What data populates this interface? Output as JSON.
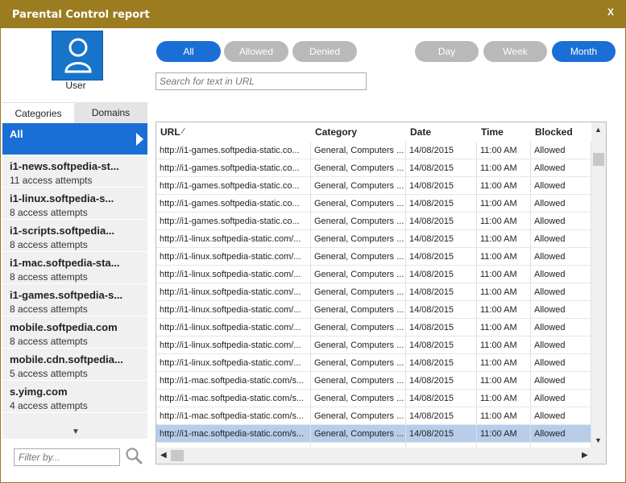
{
  "window": {
    "title": "Parental Control report",
    "close_label": "X"
  },
  "user": {
    "label": "User"
  },
  "tabs": {
    "categories": "Categories",
    "domains": "Domains"
  },
  "filters": {
    "all": "All",
    "allowed": "Allowed",
    "denied": "Denied"
  },
  "periods": {
    "day": "Day",
    "week": "Week",
    "month": "Month"
  },
  "search": {
    "url_placeholder": "Search for text in URL",
    "filter_placeholder": "Filter by..."
  },
  "domains": [
    {
      "name": "All",
      "sub": ""
    },
    {
      "name": "i1-news.softpedia-st...",
      "sub": "11 access attempts"
    },
    {
      "name": "i1-linux.softpedia-s...",
      "sub": "8 access attempts"
    },
    {
      "name": "i1-scripts.softpedia...",
      "sub": "8 access attempts"
    },
    {
      "name": "i1-mac.softpedia-sta...",
      "sub": "8 access attempts"
    },
    {
      "name": "i1-games.softpedia-s...",
      "sub": "8 access attempts"
    },
    {
      "name": "mobile.softpedia.com",
      "sub": "8 access attempts"
    },
    {
      "name": "mobile.cdn.softpedia...",
      "sub": "5 access attempts"
    },
    {
      "name": "s.yimg.com",
      "sub": "4 access attempts"
    }
  ],
  "columns": {
    "url": "URL",
    "url_sort": "⁄",
    "category": "Category",
    "date": "Date",
    "time": "Time",
    "blocked": "Blocked"
  },
  "rows": [
    {
      "url": "http://i1-games.softpedia-static.co...",
      "category": "General, Computers ...",
      "date": "14/08/2015",
      "time": "11:00 AM",
      "blocked": "Allowed"
    },
    {
      "url": "http://i1-games.softpedia-static.co...",
      "category": "General, Computers ...",
      "date": "14/08/2015",
      "time": "11:00 AM",
      "blocked": "Allowed"
    },
    {
      "url": "http://i1-games.softpedia-static.co...",
      "category": "General, Computers ...",
      "date": "14/08/2015",
      "time": "11:00 AM",
      "blocked": "Allowed"
    },
    {
      "url": "http://i1-games.softpedia-static.co...",
      "category": "General, Computers ...",
      "date": "14/08/2015",
      "time": "11:00 AM",
      "blocked": "Allowed"
    },
    {
      "url": "http://i1-games.softpedia-static.co...",
      "category": "General, Computers ...",
      "date": "14/08/2015",
      "time": "11:00 AM",
      "blocked": "Allowed"
    },
    {
      "url": "http://i1-linux.softpedia-static.com/...",
      "category": "General, Computers ...",
      "date": "14/08/2015",
      "time": "11:00 AM",
      "blocked": "Allowed"
    },
    {
      "url": "http://i1-linux.softpedia-static.com/...",
      "category": "General, Computers ...",
      "date": "14/08/2015",
      "time": "11:00 AM",
      "blocked": "Allowed"
    },
    {
      "url": "http://i1-linux.softpedia-static.com/...",
      "category": "General, Computers ...",
      "date": "14/08/2015",
      "time": "11:00 AM",
      "blocked": "Allowed"
    },
    {
      "url": "http://i1-linux.softpedia-static.com/...",
      "category": "General, Computers ...",
      "date": "14/08/2015",
      "time": "11:00 AM",
      "blocked": "Allowed"
    },
    {
      "url": "http://i1-linux.softpedia-static.com/...",
      "category": "General, Computers ...",
      "date": "14/08/2015",
      "time": "11:00 AM",
      "blocked": "Allowed"
    },
    {
      "url": "http://i1-linux.softpedia-static.com/...",
      "category": "General, Computers ...",
      "date": "14/08/2015",
      "time": "11:00 AM",
      "blocked": "Allowed"
    },
    {
      "url": "http://i1-linux.softpedia-static.com/...",
      "category": "General, Computers ...",
      "date": "14/08/2015",
      "time": "11:00 AM",
      "blocked": "Allowed"
    },
    {
      "url": "http://i1-linux.softpedia-static.com/...",
      "category": "General, Computers ...",
      "date": "14/08/2015",
      "time": "11:00 AM",
      "blocked": "Allowed"
    },
    {
      "url": "http://i1-mac.softpedia-static.com/s...",
      "category": "General, Computers ...",
      "date": "14/08/2015",
      "time": "11:00 AM",
      "blocked": "Allowed"
    },
    {
      "url": "http://i1-mac.softpedia-static.com/s...",
      "category": "General, Computers ...",
      "date": "14/08/2015",
      "time": "11:00 AM",
      "blocked": "Allowed"
    },
    {
      "url": "http://i1-mac.softpedia-static.com/s...",
      "category": "General, Computers ...",
      "date": "14/08/2015",
      "time": "11:00 AM",
      "blocked": "Allowed"
    },
    {
      "url": "http://i1-mac.softpedia-static.com/s...",
      "category": "General, Computers ...",
      "date": "14/08/2015",
      "time": "11:00 AM",
      "blocked": "Allowed"
    },
    {
      "url": "http://i1-mac.softpedia-static.com/s...",
      "category": "General, Computers ...",
      "date": "14/08/2015",
      "time": "11:00 AM",
      "blocked": "Allowed"
    }
  ],
  "colors": {
    "titlebar": "#9b7c20",
    "accent": "#1a6fd6",
    "pill_inactive": "#b9b9b9",
    "selected_row": "#b7cde9"
  },
  "icons": {
    "user": "user-icon",
    "search": "magnifier-icon",
    "close": "close-icon"
  }
}
